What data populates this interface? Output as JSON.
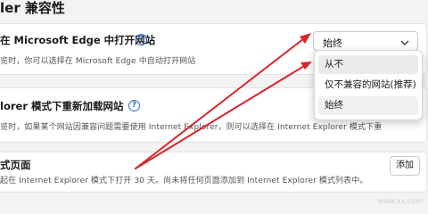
{
  "page": {
    "heading": "ler 兼容性"
  },
  "edge_open_setting": {
    "title": "在 Microsoft Edge 中打开网站",
    "description": "览时，你可以选择在 Microsoft Edge 中自动打开网站",
    "select_value": "始终",
    "options": [
      "从不",
      "仅不兼容的网站(推荐)",
      "始终"
    ]
  },
  "ie_reload_setting": {
    "title": "lorer 模式下重新加载网站",
    "description": "览时，如果某个网站因兼容问题需要使用 Internet Explorer，则可以选择在 Internet Explorer 模式下重"
  },
  "ie_pages_setting": {
    "title": "式页面",
    "description": "起在 Internet Explorer 模式下打开 30 天。尚未将任何页面添加到 Internet Explorer 模式列表中。",
    "add_label": "添加"
  },
  "annotation": {
    "arrow_color": "#d7262a"
  },
  "watermark": "www.xx.com"
}
